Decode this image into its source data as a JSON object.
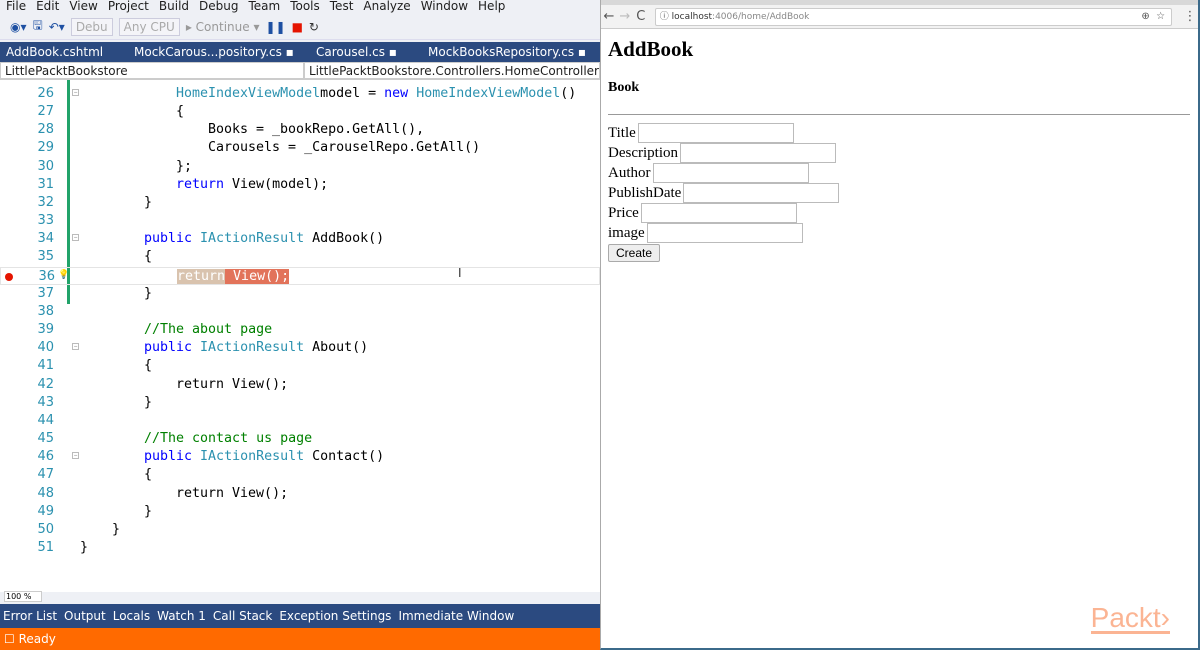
{
  "ide": {
    "menu": [
      "File",
      "Edit",
      "View",
      "Project",
      "Build",
      "Debug",
      "Team",
      "Tools",
      "Test",
      "Analyze",
      "Window",
      "Help"
    ],
    "toolbar": {
      "config": "Debu",
      "platform": "Any CPU",
      "continue": "Continue"
    },
    "tabs": [
      "AddBook.cshtml",
      "MockCarous...pository.cs ▪",
      "Carousel.cs ▪",
      "MockBooksRepository.cs ▪"
    ],
    "nav": {
      "project": "LittlePacktBookstore",
      "class": "LittlePacktBookstore.Controllers.HomeController"
    },
    "lines": [
      {
        "n": 26,
        "i": 3,
        "t": [
          [
            "type",
            "HomeIndexViewModel"
          ],
          [
            "",
            "model = "
          ],
          [
            "kw",
            "new "
          ],
          [
            "type",
            "HomeIndexViewModel"
          ],
          [
            "",
            "()"
          ]
        ]
      },
      {
        "n": 27,
        "i": 3,
        "t": [
          [
            "",
            "{"
          ]
        ]
      },
      {
        "n": 28,
        "i": 4,
        "t": [
          [
            "",
            "Books = _bookRepo.GetAll(),"
          ]
        ]
      },
      {
        "n": 29,
        "i": 4,
        "t": [
          [
            "",
            "Carousels = _CarouselRepo.GetAll()"
          ]
        ]
      },
      {
        "n": 30,
        "i": 3,
        "t": [
          [
            "",
            "};"
          ]
        ]
      },
      {
        "n": 31,
        "i": 3,
        "t": [
          [
            "kw",
            "return "
          ],
          [
            "",
            "View(model);"
          ]
        ]
      },
      {
        "n": 32,
        "i": 2,
        "t": [
          [
            "",
            "}"
          ]
        ]
      },
      {
        "n": 33,
        "i": 0,
        "t": []
      },
      {
        "n": 34,
        "i": 2,
        "t": [
          [
            "kw",
            "public "
          ],
          [
            "type",
            "IActionResult "
          ],
          [
            "",
            "AddBook()"
          ]
        ]
      },
      {
        "n": 35,
        "i": 2,
        "t": [
          [
            "",
            "{"
          ]
        ]
      },
      {
        "n": 36,
        "i": 3,
        "t": [
          [
            "hlret",
            "return"
          ],
          [
            "hlview",
            " View();"
          ]
        ],
        "breakpoint": true
      },
      {
        "n": 37,
        "i": 2,
        "t": [
          [
            "",
            "}"
          ]
        ]
      },
      {
        "n": 38,
        "i": 0,
        "t": []
      },
      {
        "n": 39,
        "i": 2,
        "t": [
          [
            "comment",
            "//The about page"
          ]
        ]
      },
      {
        "n": 40,
        "i": 2,
        "t": [
          [
            "kw",
            "public "
          ],
          [
            "type",
            "IActionResult "
          ],
          [
            "",
            "About()"
          ]
        ]
      },
      {
        "n": 41,
        "i": 2,
        "t": [
          [
            "",
            "{"
          ]
        ]
      },
      {
        "n": 42,
        "i": 3,
        "t": [
          [
            "",
            "return View();"
          ]
        ]
      },
      {
        "n": 43,
        "i": 2,
        "t": [
          [
            "",
            "}"
          ]
        ]
      },
      {
        "n": 44,
        "i": 0,
        "t": []
      },
      {
        "n": 45,
        "i": 2,
        "t": [
          [
            "comment",
            "//The contact us page"
          ]
        ]
      },
      {
        "n": 46,
        "i": 2,
        "t": [
          [
            "kw",
            "public "
          ],
          [
            "type",
            "IActionResult "
          ],
          [
            "",
            "Contact()"
          ]
        ]
      },
      {
        "n": 47,
        "i": 2,
        "t": [
          [
            "",
            "{"
          ]
        ]
      },
      {
        "n": 48,
        "i": 3,
        "t": [
          [
            "",
            "return View();"
          ]
        ]
      },
      {
        "n": 49,
        "i": 2,
        "t": [
          [
            "",
            "}"
          ]
        ]
      },
      {
        "n": 50,
        "i": 1,
        "t": [
          [
            "",
            "}"
          ]
        ]
      },
      {
        "n": 51,
        "i": 0,
        "t": [
          [
            "",
            "}"
          ]
        ]
      }
    ],
    "zoom": "100 %",
    "bottom_tabs": [
      "Error List",
      "Output",
      "Locals",
      "Watch 1",
      "Call Stack",
      "Exception Settings",
      "Immediate Window"
    ],
    "status": "Ready",
    "status_color": "#ff6a00"
  },
  "browser": {
    "url_host": "localhost",
    "url_path": ":4006/home/AddBook",
    "h1": "AddBook",
    "h4": "Book",
    "fields": [
      "Title",
      "Description",
      "Author",
      "PublishDate",
      "Price",
      "image"
    ],
    "button": "Create",
    "logo": "Packt>"
  }
}
